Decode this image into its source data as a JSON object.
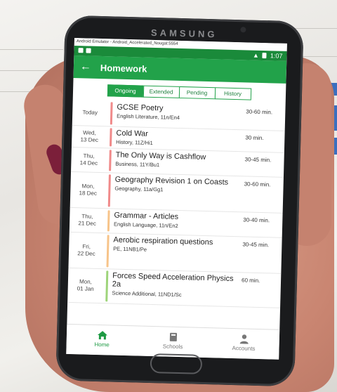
{
  "emulator_title": "Android Emulator - Android_Accelerated_Nougat:5554",
  "device_brand": "SAMSUNG",
  "status_bar": {
    "time": "1:07"
  },
  "app_bar": {
    "title": "Homework"
  },
  "tabs": [
    {
      "label": "Ongoing",
      "active": true
    },
    {
      "label": "Extended",
      "active": false
    },
    {
      "label": "Pending",
      "active": false
    },
    {
      "label": "History",
      "active": false
    }
  ],
  "homework": [
    {
      "date": "Today",
      "title": "GCSE Poetry",
      "subtitle": "English Literature, 11n/En4",
      "duration": "30-60 min.",
      "color": "#f08a8a"
    },
    {
      "date": "Wed,\n13 Dec",
      "title": "Cold War",
      "subtitle": "History, 11Z/Hi1",
      "duration": "30 min.",
      "color": "#f08a8a"
    },
    {
      "date": "Thu,\n14 Dec",
      "title": "The Only Way is Cashflow",
      "subtitle": "Business, 11Y/Bu1",
      "duration": "30-45 min.",
      "color": "#f08a8a"
    },
    {
      "date": "Mon,\n18 Dec",
      "title": "Geography Revision 1 on Coasts",
      "subtitle": "Geography, 11a/Gg1",
      "duration": "30-60 min.",
      "color": "#f08a8a"
    },
    {
      "date": "Thu,\n21 Dec",
      "title": "Grammar - Articles",
      "subtitle": "English Language, 11n/En2",
      "duration": "30-40 min.",
      "color": "#f7c48a"
    },
    {
      "date": "Fri,\n22 Dec",
      "title": "Aerobic respiration questions",
      "subtitle": "PE, 11NB1/Pe",
      "duration": "30-45 min.",
      "color": "#f7c48a"
    },
    {
      "date": "Mon,\n01 Jan",
      "title": "Forces Speed Acceleration Physics 2a",
      "subtitle": "Science Additional, 11ND1/Sc",
      "duration": "60 min.",
      "color": "#9ed47a"
    }
  ],
  "bottom_nav": [
    {
      "label": "Home",
      "icon": "home-icon",
      "active": true
    },
    {
      "label": "Schools",
      "icon": "school-icon",
      "active": false
    },
    {
      "label": "Accounts",
      "icon": "person-icon",
      "active": false
    }
  ],
  "colors": {
    "primary": "#22a24a",
    "status_bar": "#1a8a3a"
  }
}
